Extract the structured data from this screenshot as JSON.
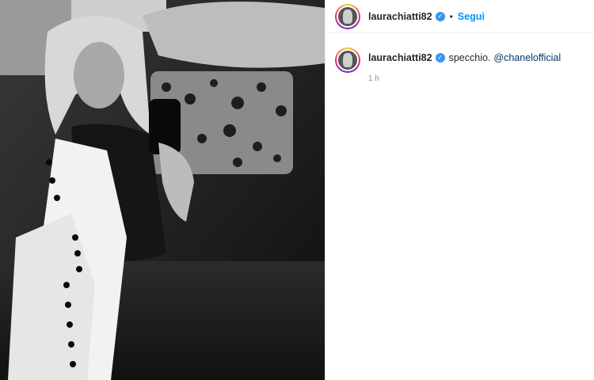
{
  "post": {
    "author": "laurachiatti82",
    "follow_label": "Segui",
    "separator": "•",
    "caption_text": "specchio.",
    "mention": "@chanelofficial",
    "time_ago": "1 h"
  },
  "icons": {
    "verified": "verified-badge-icon"
  },
  "colors": {
    "link": "#0095f6",
    "mention": "#00376b",
    "verified": "#3897f0"
  }
}
